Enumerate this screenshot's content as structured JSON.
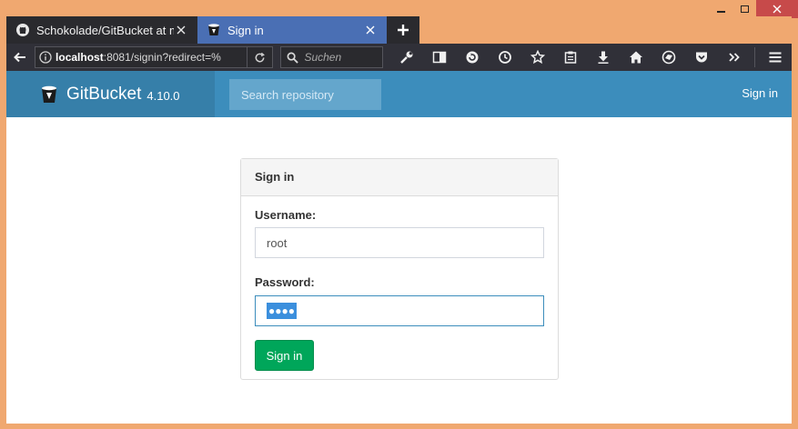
{
  "browser": {
    "tabs": [
      {
        "title": "Schokolade/GitBucket at ma",
        "active": false,
        "icon": "github-icon"
      },
      {
        "title": "Sign in",
        "active": true,
        "icon": "gitbucket-icon"
      }
    ],
    "url": {
      "host": "localhost",
      "rest": ":8081/signin?redirect=%"
    },
    "search_placeholder": "Suchen"
  },
  "app": {
    "name": "GitBucket",
    "version": "4.10.0",
    "search_placeholder": "Search repository",
    "signin_link": "Sign in",
    "colors": {
      "header": "#3c8dbc",
      "brand": "#367fa9",
      "button": "#00a65a"
    }
  },
  "signin_form": {
    "heading": "Sign in",
    "username_label": "Username:",
    "username_value": "root",
    "password_label": "Password:",
    "password_masked": "●●●●",
    "submit_label": "Sign in"
  }
}
